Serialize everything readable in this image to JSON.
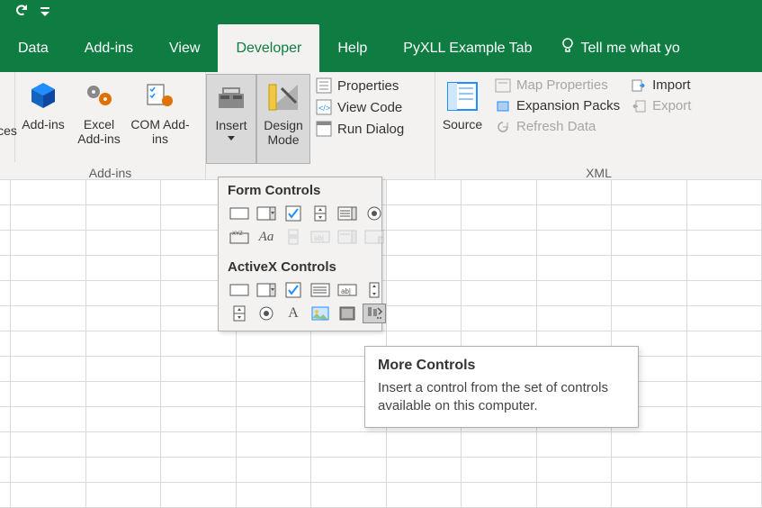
{
  "tabs": {
    "data": "Data",
    "addins": "Add-ins",
    "view": "View",
    "developer": "Developer",
    "help": "Help",
    "pyxll": "PyXLL Example Tab",
    "tellme": "Tell me what yo"
  },
  "ribbon": {
    "partial_left": "ces",
    "addins_group": {
      "label": "Add-ins",
      "addins": "Add-ins",
      "excel": "Excel Add-ins",
      "com": "COM Add-ins"
    },
    "controls": {
      "insert": "Insert",
      "design": "Design Mode",
      "properties": "Properties",
      "viewcode": "View Code",
      "rundialog": "Run Dialog"
    },
    "xml": {
      "label": "XML",
      "source": "Source",
      "map": "Map Properties",
      "expansion": "Expansion Packs",
      "refresh": "Refresh Data",
      "import": "Import",
      "export": "Export"
    }
  },
  "popup": {
    "form_header": "Form Controls",
    "activex_header": "ActiveX Controls"
  },
  "tooltip": {
    "title": "More Controls",
    "body": "Insert a control from the set of controls available on this computer."
  }
}
